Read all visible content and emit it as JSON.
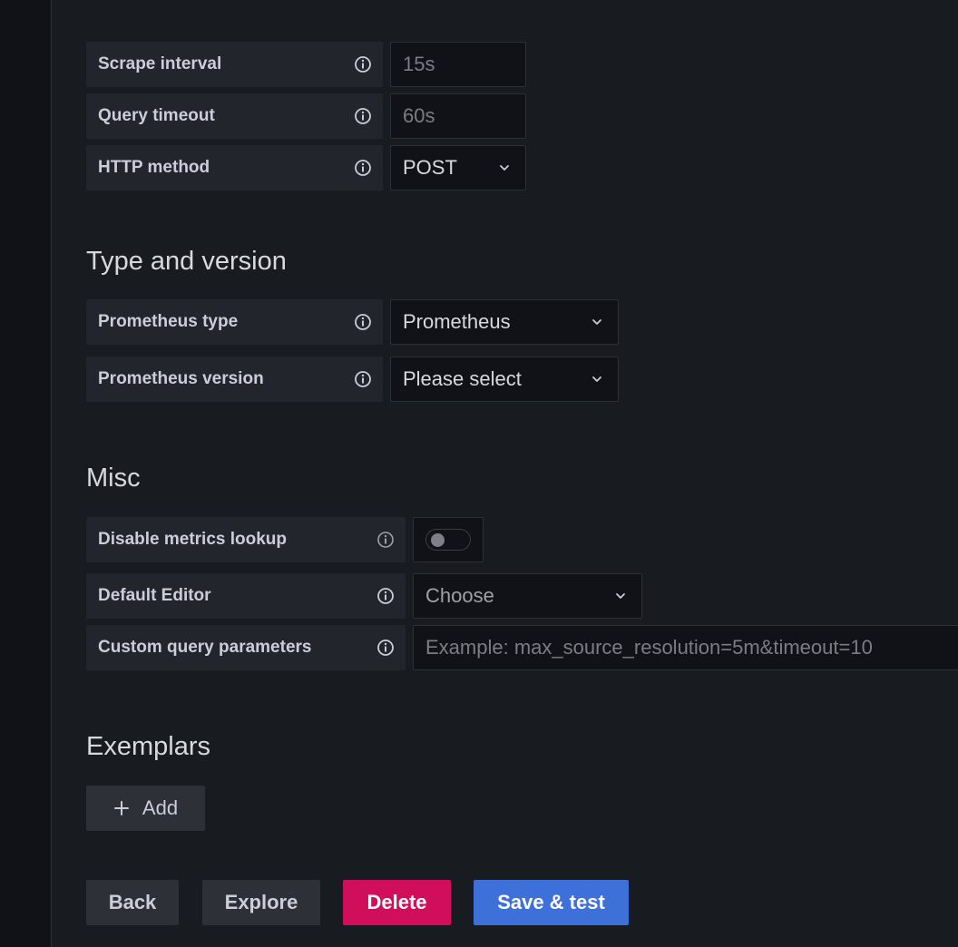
{
  "http_section": {
    "scrape_interval": {
      "label": "Scrape interval",
      "placeholder": "15s"
    },
    "query_timeout": {
      "label": "Query timeout",
      "placeholder": "60s"
    },
    "http_method": {
      "label": "HTTP method",
      "value": "POST"
    }
  },
  "type_version": {
    "title": "Type and version",
    "prometheus_type": {
      "label": "Prometheus type",
      "value": "Prometheus"
    },
    "prometheus_version": {
      "label": "Prometheus version",
      "value": "Please select"
    }
  },
  "misc": {
    "title": "Misc",
    "disable_metrics_lookup": {
      "label": "Disable metrics lookup",
      "enabled": false
    },
    "default_editor": {
      "label": "Default Editor",
      "value": "Choose"
    },
    "custom_query_params": {
      "label": "Custom query parameters",
      "placeholder": "Example: max_source_resolution=5m&timeout=10"
    }
  },
  "exemplars": {
    "title": "Exemplars",
    "add_label": "Add"
  },
  "actions": {
    "back": "Back",
    "explore": "Explore",
    "delete": "Delete",
    "save_test": "Save & test"
  },
  "colors": {
    "background": "#181b1f",
    "danger": "#d10e5c",
    "primary": "#3d71d9"
  },
  "icons": [
    "info-icon",
    "chevron-down-icon",
    "plus-icon"
  ]
}
